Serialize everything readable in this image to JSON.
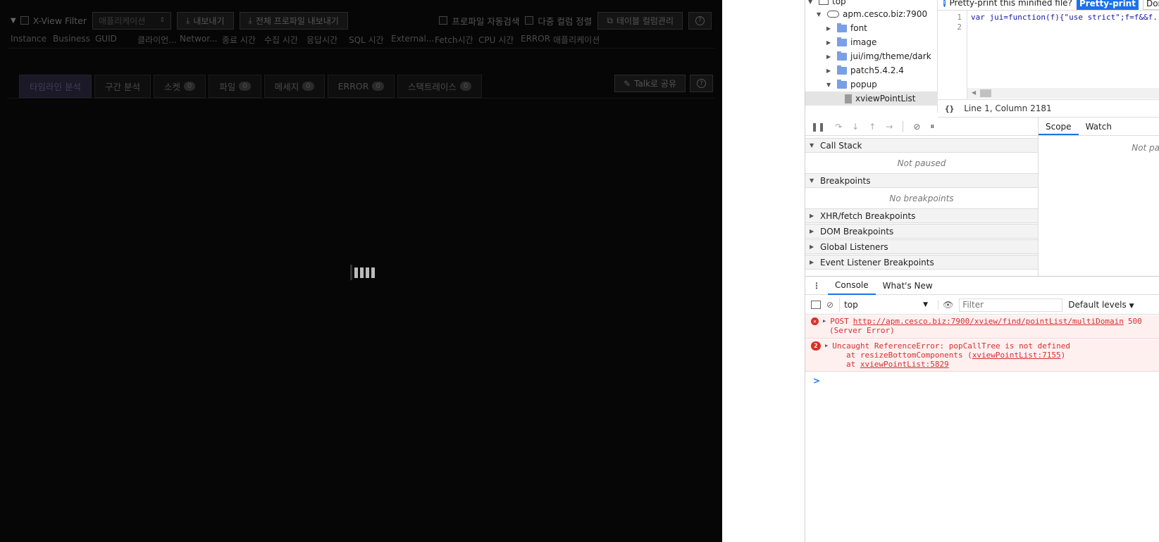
{
  "app": {
    "toolbar": {
      "filter_label": "X-View Filter",
      "app_select_placeholder": "애플리케이션",
      "export_label": "내보내기",
      "export_all_label": "전체 프로파일 내보내기",
      "auto_search_label": "프로파일 자동검색",
      "multi_col_sort_label": "다중 컬럼 정렬",
      "table_cols_label": "테이블 컬럼관리",
      "help": "?"
    },
    "columns": [
      "Instance",
      "Business",
      "GUID",
      "클라이언...",
      "Networ...",
      "종료 시간",
      "수집 시간",
      "응답시간",
      "SQL 시간",
      "External...",
      "Fetch시간",
      "CPU 시간",
      "ERROR",
      "애플리케이션"
    ],
    "tabs": [
      {
        "label": "타임라인 분석",
        "badge": null
      },
      {
        "label": "구간 분석",
        "badge": null
      },
      {
        "label": "소켓",
        "badge": "0"
      },
      {
        "label": "파일",
        "badge": "0"
      },
      {
        "label": "메세지",
        "badge": "0"
      },
      {
        "label": "ERROR",
        "badge": "0"
      },
      {
        "label": "스택트레이스",
        "badge": "0"
      }
    ],
    "share_label": "Talk로 공유",
    "help": "?"
  },
  "devtools": {
    "tree": {
      "top": "top",
      "domain": "apm.cesco.biz:7900",
      "folders": [
        "font",
        "image",
        "jui/img/theme/dark",
        "patch5.4.2.4",
        "popup"
      ],
      "selected_file": "xviewPointList"
    },
    "infobar": {
      "message": "Pretty-print this minified file?",
      "pretty_print_button": "Pretty-print",
      "dont_show_button": "Don't sh"
    },
    "editor": {
      "line1_num": "1",
      "line2_num": "2",
      "line1_code": "var jui=function(f){\"use strict\";f=f&&f.",
      "status": "Line 1, Column 2181"
    },
    "debugger": {
      "call_stack": "Call Stack",
      "not_paused": "Not paused",
      "breakpoints": "Breakpoints",
      "no_breakpoints": "No breakpoints",
      "xhr": "XHR/fetch Breakpoints",
      "dom": "DOM Breakpoints",
      "global": "Global Listeners",
      "event": "Event Listener Breakpoints",
      "scope_tab": "Scope",
      "watch_tab": "Watch",
      "scope_not_paused": "Not pa"
    },
    "drawer": {
      "console_tab": "Console",
      "whats_new_tab": "What's New",
      "context": "top",
      "filter_placeholder": "Filter",
      "levels": "Default levels"
    },
    "console": {
      "err1_method": "POST",
      "err1_url": "http://apm.cesco.biz:7900/xview/find/pointList/multiDomain",
      "err1_status": "500",
      "err1_status_text": "(Server Error)",
      "err2_count": "2",
      "err2_message": "Uncaught ReferenceError: popCallTree is not defined",
      "err2_at1_prefix": "at resizeBottomComponents (",
      "err2_at1_link": "xviewPointList:7155",
      "err2_at1_suffix": ")",
      "err2_at2_prefix": "at",
      "err2_at2_link": "xviewPointList:5829",
      "prompt": ">"
    }
  }
}
